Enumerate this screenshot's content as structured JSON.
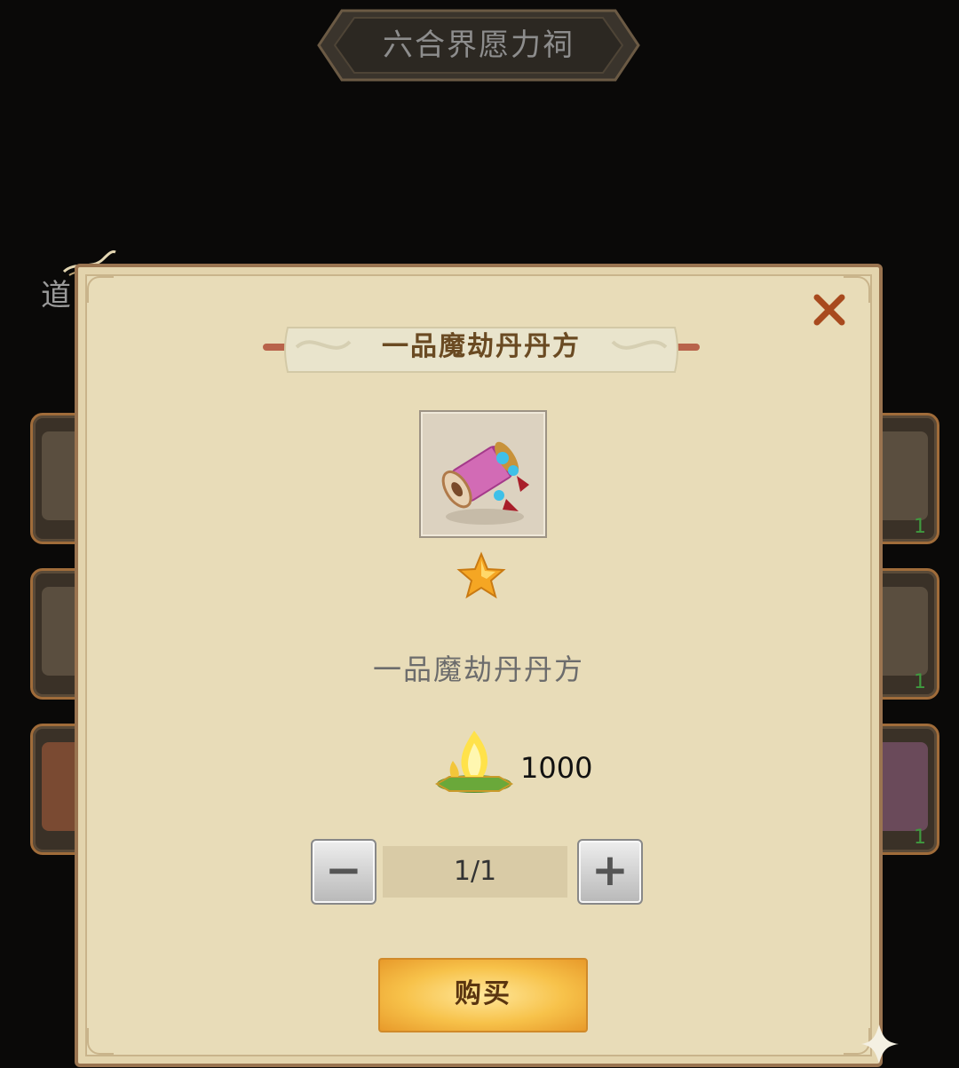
{
  "page_title": "六合界愿力祠",
  "side_label": "道",
  "background_slots": [
    {
      "count": ""
    },
    {
      "count": "1"
    },
    {
      "count": ""
    },
    {
      "count": "1"
    },
    {
      "count": ""
    },
    {
      "count": "1"
    }
  ],
  "dialog": {
    "header_title": "一品魔劫丹丹方",
    "item_name": "一品魔劫丹丹方",
    "item_icon": "recipe-scroll-icon",
    "star_count": 1,
    "price": "1000",
    "price_icon": "spirit-flame-currency-icon",
    "quantity": "1/1",
    "minus_label": "−",
    "plus_label": "+",
    "buy_label": "购买",
    "close_icon": "close-x-icon"
  },
  "colors": {
    "background": "#0a0908",
    "dialog_bg": "#e8dcb8",
    "dialog_border": "#9a7450",
    "header_text": "#6a4a22",
    "buy_button": "#f7c24a",
    "close_x": "#a84a1e"
  }
}
